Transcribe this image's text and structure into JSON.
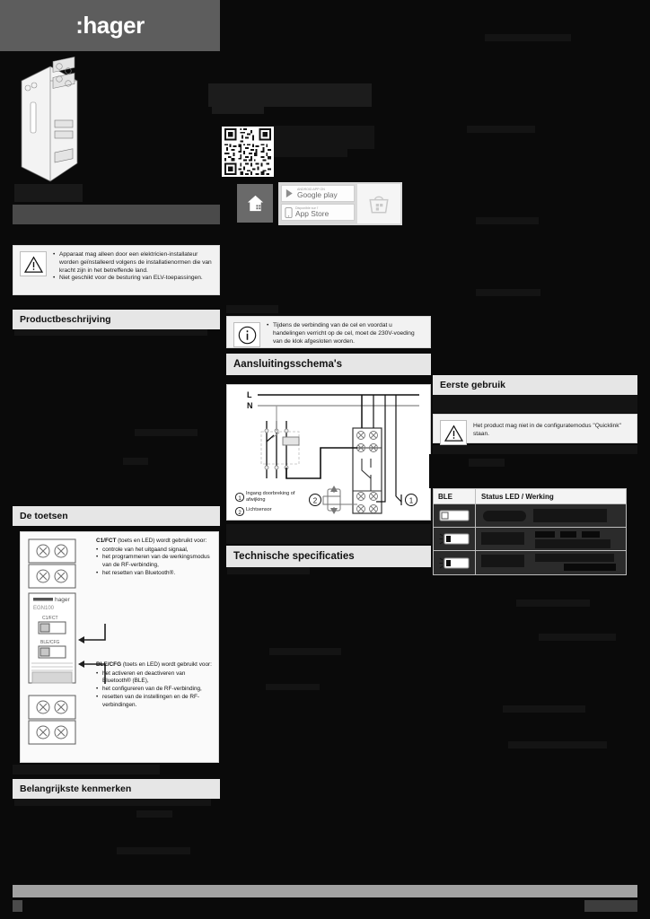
{
  "brand": {
    "logo": ":hager",
    "logo_color": "#ffffff",
    "bar_color": "#5d5d5d"
  },
  "document": {
    "language": "nl",
    "page_background": "#0a0a0a",
    "redaction_note": "Body copy is redacted (blacked-out) in this scan; only headings, boxed notes and diagram labels remain legible."
  },
  "warning_box": {
    "icon": "warning-triangle-icon",
    "bullets": [
      "Apparaat mag alleen door een elektricien-installateur worden geïnstalleerd volgens de installatienormen die van kracht zijn in het betreffende land.",
      "Niet geschikt voor de besturing van ELV-toepassingen."
    ]
  },
  "info_box": {
    "icon": "info-circle-icon",
    "bullets": [
      "Tijdens de verbinding van de cel en voordat u handelingen verricht op de cel, moet de 230V-voeding van de klok afgesloten worden."
    ]
  },
  "quicklink_box": {
    "icon": "warning-triangle-icon",
    "text": "Het product mag niet in de configuratemodus \"Quicklink\" staan."
  },
  "sections": {
    "productbeschrijving": "Productbeschrijving",
    "de_toetsen": "De toetsen",
    "belangrijkste_kenmerken": "Belangrijkste kenmerken",
    "aansluitingsschemas": "Aansluitingsschema's",
    "technische_specificaties": "Technische specificaties",
    "eerste_gebruik": "Eerste gebruik"
  },
  "toetsen": {
    "c1": {
      "title": "C1/FCT",
      "title_suffix": "(toets en LED) wordt gebruikt voor:",
      "bullets": [
        "controle van het uitgaand signaal,",
        "het programmeren van de werkingsmodus van de RF-verbinding,",
        "het resetten van Bluetooth®."
      ]
    },
    "ble": {
      "title": "BLE/CFG",
      "title_suffix": "(toets en LED) wordt gebruikt voor:",
      "bullets": [
        "het activeren en deactiveren van Bluetooth® (BLE),",
        "het configureren van de RF-verbinding,",
        "resetten van de instellingen en de RF-verbindingen."
      ]
    },
    "device_labels": {
      "brand": "hager",
      "model": "EGN100",
      "button_top": "C1/FCT",
      "button_bottom": "BLE/CFG"
    }
  },
  "diagram": {
    "rail_labels": [
      "L",
      "N"
    ],
    "callouts": [
      {
        "num": "1",
        "text": "Ingang doorbreking of afwijking"
      },
      {
        "num": "2",
        "text": "Lichtsensor"
      }
    ],
    "markers": {
      "one": "1",
      "two": "2"
    }
  },
  "ble_table": {
    "headers": [
      "BLE",
      "Status LED / Werking"
    ],
    "rows": [
      {
        "icon": "led-off-icon",
        "status": "",
        "werking": ""
      },
      {
        "icon": "led-blinking-icon",
        "status": "",
        "werking": ""
      },
      {
        "icon": "led-blinking-icon",
        "status": "",
        "werking": ""
      }
    ]
  },
  "app_promo": {
    "qr": "qr-code-icon",
    "home_icon": "home-app-icon",
    "badges": [
      {
        "small": "ANDROID APP ON",
        "big": "Google play",
        "icon": "google-play-icon"
      },
      {
        "small": "Disponible sur l'",
        "big": "App Store",
        "icon": "app-store-icon"
      }
    ],
    "right_badge": "app-gallery-icon"
  }
}
